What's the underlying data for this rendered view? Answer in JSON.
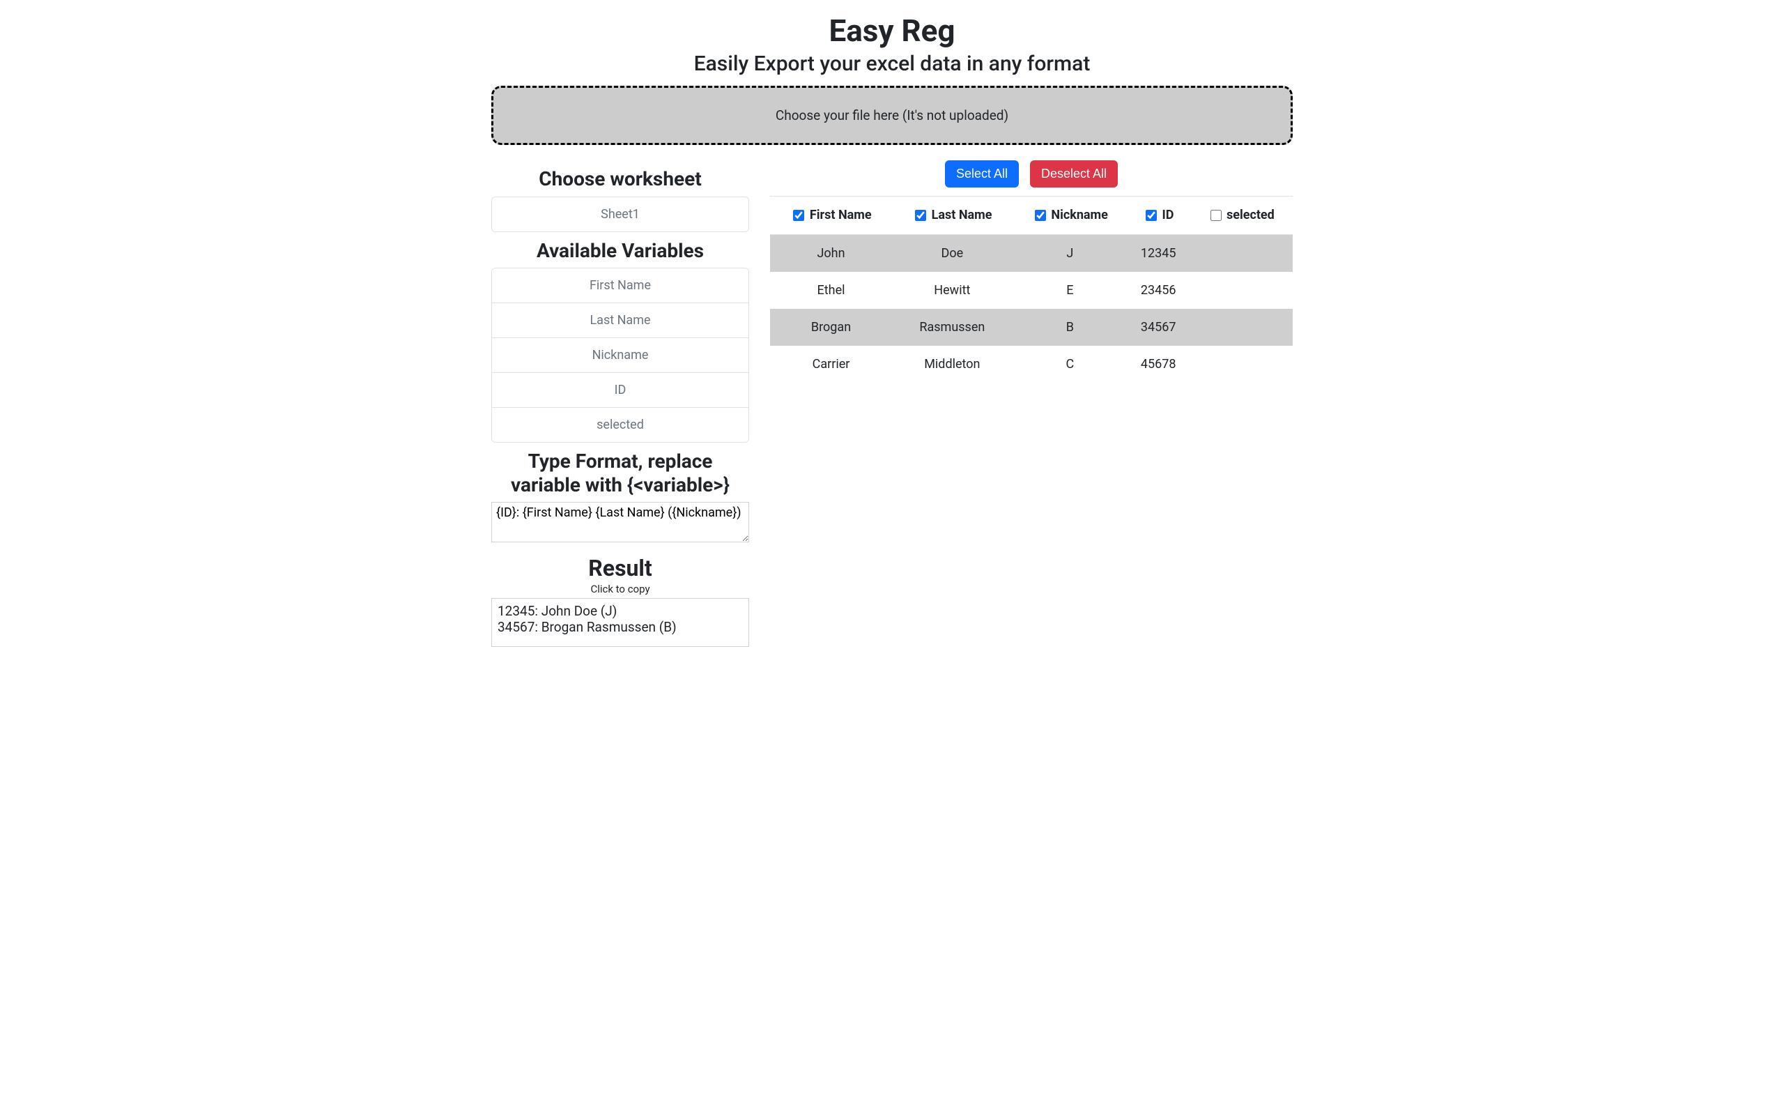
{
  "header": {
    "title": "Easy Reg",
    "subtitle": "Easily Export your excel data in any format"
  },
  "dropzone": {
    "text": "Choose your file here (It's not uploaded)"
  },
  "worksheet": {
    "heading": "Choose worksheet",
    "items": [
      "Sheet1"
    ]
  },
  "variables": {
    "heading": "Available Variables",
    "items": [
      "First Name",
      "Last Name",
      "Nickname",
      "ID",
      "selected"
    ]
  },
  "format": {
    "heading": "Type Format, replace variable with {<variable>}",
    "value": "{ID}: {First Name} {Last Name} ({Nickname})"
  },
  "result": {
    "heading": "Result",
    "hint": "Click to copy",
    "text": "12345: John Doe (J)\n34567: Brogan Rasmussen (B)"
  },
  "buttons": {
    "select_all": "Select All",
    "deselect_all": "Deselect All"
  },
  "table": {
    "headers": [
      {
        "label": "First Name",
        "checked": true
      },
      {
        "label": "Last Name",
        "checked": true
      },
      {
        "label": "Nickname",
        "checked": true
      },
      {
        "label": "ID",
        "checked": true
      },
      {
        "label": "selected",
        "checked": false
      }
    ],
    "rows": [
      {
        "cells": [
          "John",
          "Doe",
          "J",
          "12345",
          ""
        ],
        "selected": true
      },
      {
        "cells": [
          "Ethel",
          "Hewitt",
          "E",
          "23456",
          ""
        ],
        "selected": false
      },
      {
        "cells": [
          "Brogan",
          "Rasmussen",
          "B",
          "34567",
          ""
        ],
        "selected": true
      },
      {
        "cells": [
          "Carrier",
          "Middleton",
          "C",
          "45678",
          ""
        ],
        "selected": false
      }
    ]
  }
}
